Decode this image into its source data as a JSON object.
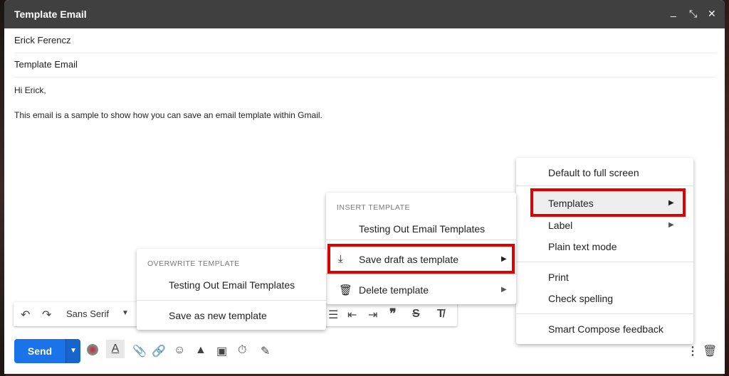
{
  "window": {
    "title": "Template Email",
    "controls": {
      "minimize": "_",
      "expand": "⤡",
      "close": "✕"
    }
  },
  "fields": {
    "to": "Erick Ferencz",
    "subject": "Template Email"
  },
  "body": {
    "greeting": "Hi Erick,",
    "paragraph": "This email is a sample to show how you can save an email template within Gmail."
  },
  "format_bar": {
    "font": "Sans Serif"
  },
  "send": {
    "label": "Send"
  },
  "more_menu": {
    "items": [
      "Default to full screen",
      "Templates",
      "Label",
      "Plain text mode",
      "Print",
      "Check spelling",
      "Smart Compose feedback"
    ]
  },
  "templates_menu": {
    "header": "INSERT TEMPLATE",
    "items": [
      "Testing Out Email Templates",
      "Save draft as template",
      "Delete template"
    ]
  },
  "overwrite_menu": {
    "header": "OVERWRITE TEMPLATE",
    "items": [
      "Testing Out Email Templates",
      "Save as new template"
    ]
  },
  "colors": {
    "highlight": "#e00000",
    "send": "#1a73e8",
    "titlebar": "#404040"
  }
}
